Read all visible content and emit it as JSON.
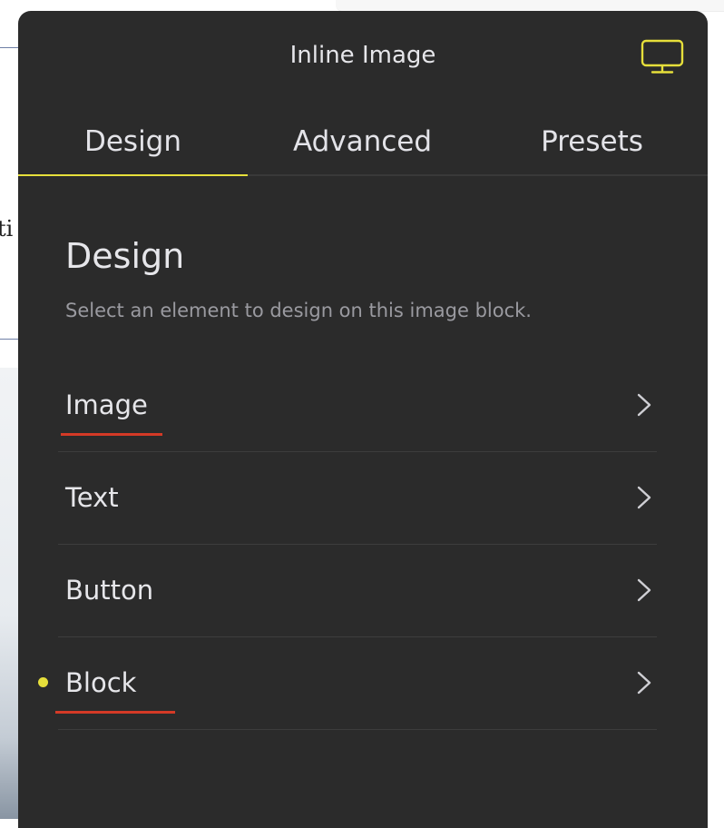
{
  "background": {
    "text_fragment": "ti"
  },
  "panel": {
    "title": "Inline Image",
    "device_icon": "desktop-monitor-icon"
  },
  "tabs": [
    {
      "label": "Design",
      "active": true
    },
    {
      "label": "Advanced",
      "active": false
    },
    {
      "label": "Presets",
      "active": false
    }
  ],
  "section": {
    "title": "Design",
    "description": "Select an element to design on this image block."
  },
  "items": [
    {
      "label": "Image",
      "underlined": true,
      "modified": false
    },
    {
      "label": "Text",
      "underlined": false,
      "modified": false
    },
    {
      "label": "Button",
      "underlined": false,
      "modified": false
    },
    {
      "label": "Block",
      "underlined": true,
      "modified": true
    }
  ],
  "colors": {
    "panel_bg": "#2b2b2b",
    "accent_yellow": "#e6df3b",
    "annotation_red": "#d43a26",
    "chevron": "#cfcfd4"
  }
}
